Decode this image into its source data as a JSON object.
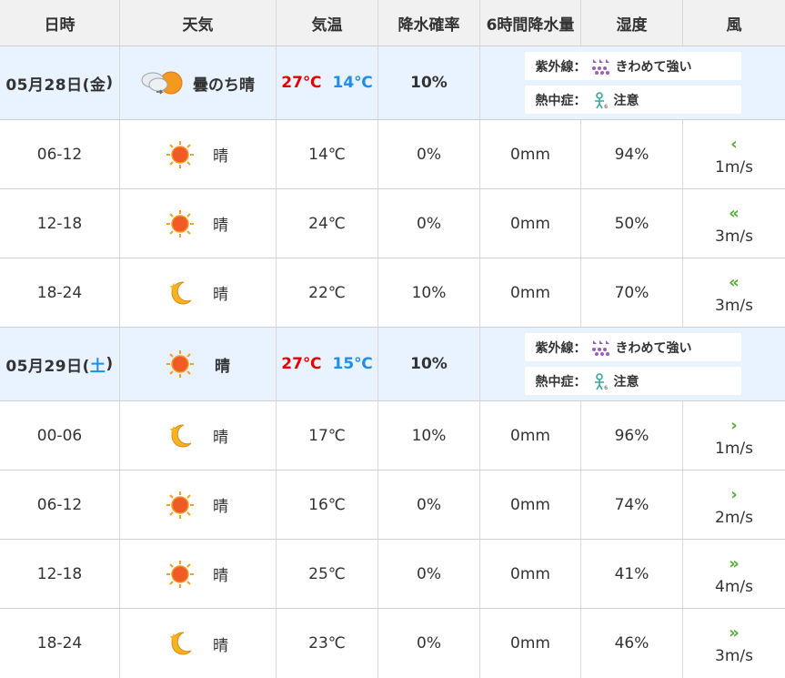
{
  "headers": [
    "日時",
    "天気",
    "気温",
    "降水確率",
    "6時間降水量",
    "湿度",
    "風"
  ],
  "days": [
    {
      "date": "05月28日(",
      "dow": "金",
      "date_end": ")",
      "dow_color": "#333333",
      "weather_icon": "cloud-then-sun-icon",
      "weather": "曇のち晴",
      "high": "27℃",
      "low": "14℃",
      "precip": "10%",
      "uv_label": "紫外線：",
      "uv_value": "きわめて強い",
      "heat_label": "熱中症：",
      "heat_value": "注意"
    },
    {
      "date": "05月29日(",
      "dow": "土",
      "date_end": ")",
      "dow_color": "#1e8ee8",
      "weather_icon": "sun-icon",
      "weather": "晴",
      "high": "27℃",
      "low": "15℃",
      "precip": "10%",
      "uv_label": "紫外線：",
      "uv_value": "きわめて強い",
      "heat_label": "熱中症：",
      "heat_value": "注意"
    }
  ],
  "rows": [
    {
      "time": "06-12",
      "icon": "sun-icon",
      "weather": "晴",
      "temp": "14℃",
      "precip": "0%",
      "rain": "0mm",
      "humidity": "94%",
      "wind_glyph": "‹",
      "wind": "1m/s"
    },
    {
      "time": "12-18",
      "icon": "sun-icon",
      "weather": "晴",
      "temp": "24℃",
      "precip": "0%",
      "rain": "0mm",
      "humidity": "50%",
      "wind_glyph": "«",
      "wind": "3m/s"
    },
    {
      "time": "18-24",
      "icon": "moon-icon",
      "weather": "晴",
      "temp": "22℃",
      "precip": "10%",
      "rain": "0mm",
      "humidity": "70%",
      "wind_glyph": "«",
      "wind": "3m/s"
    },
    {
      "time": "00-06",
      "icon": "moon-icon",
      "weather": "晴",
      "temp": "17℃",
      "precip": "10%",
      "rain": "0mm",
      "humidity": "96%",
      "wind_glyph": "›",
      "wind": "1m/s"
    },
    {
      "time": "06-12",
      "icon": "sun-icon",
      "weather": "晴",
      "temp": "16℃",
      "precip": "0%",
      "rain": "0mm",
      "humidity": "74%",
      "wind_glyph": "›",
      "wind": "2m/s"
    },
    {
      "time": "12-18",
      "icon": "sun-icon",
      "weather": "晴",
      "temp": "25℃",
      "precip": "0%",
      "rain": "0mm",
      "humidity": "41%",
      "wind_glyph": "»",
      "wind": "4m/s"
    },
    {
      "time": "18-24",
      "icon": "moon-icon",
      "weather": "晴",
      "temp": "23℃",
      "precip": "0%",
      "rain": "0mm",
      "humidity": "46%",
      "wind_glyph": "»",
      "wind": "3m/s"
    }
  ],
  "colors": {
    "high": "#e50000",
    "low": "#1e8ee8",
    "saturday": "#1e8ee8",
    "wind": "#56a93a",
    "day_bg": "#e9f2ff",
    "header_bg": "#f1f1f1"
  }
}
